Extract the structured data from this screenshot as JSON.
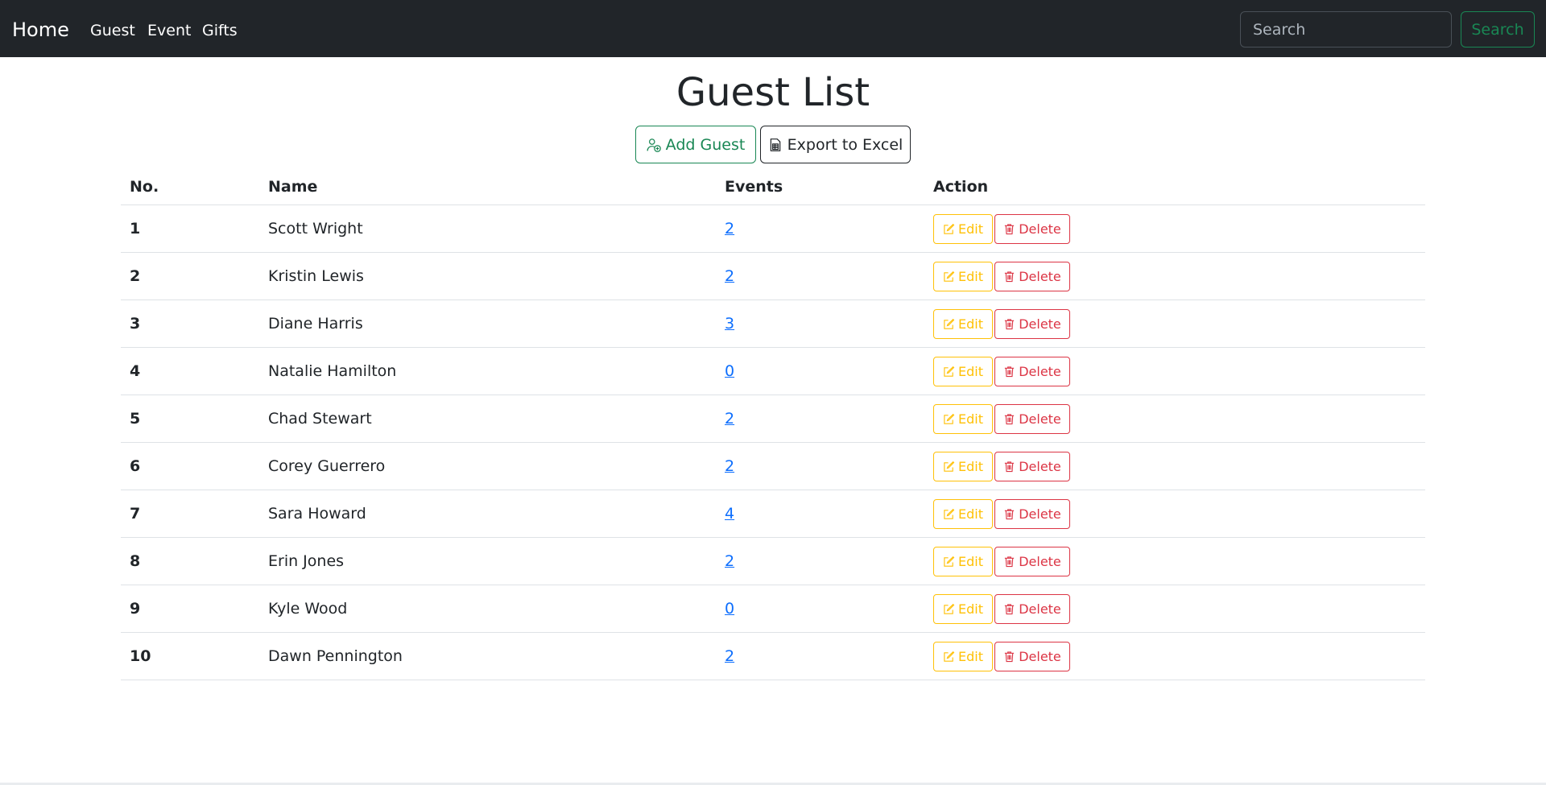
{
  "navbar": {
    "brand": "Home",
    "links": [
      "Guest",
      "Event",
      "Gifts"
    ],
    "search": {
      "placeholder": "Search",
      "button_label": "Search"
    }
  },
  "page": {
    "title": "Guest List",
    "add_button": "Add Guest",
    "export_button": "Export to Excel"
  },
  "table": {
    "headers": {
      "no": "No.",
      "name": "Name",
      "events": "Events",
      "action": "Action"
    },
    "rows": [
      {
        "no": "1",
        "name": "Scott Wright",
        "events": "2"
      },
      {
        "no": "2",
        "name": "Kristin Lewis",
        "events": "2"
      },
      {
        "no": "3",
        "name": "Diane Harris",
        "events": "3"
      },
      {
        "no": "4",
        "name": "Natalie Hamilton",
        "events": "0"
      },
      {
        "no": "5",
        "name": "Chad Stewart",
        "events": "2"
      },
      {
        "no": "6",
        "name": "Corey Guerrero",
        "events": "2"
      },
      {
        "no": "7",
        "name": "Sara Howard",
        "events": "4"
      },
      {
        "no": "8",
        "name": "Erin Jones",
        "events": "2"
      },
      {
        "no": "9",
        "name": "Kyle Wood",
        "events": "0"
      },
      {
        "no": "10",
        "name": "Dawn Pennington",
        "events": "2"
      }
    ],
    "edit_label": "Edit",
    "delete_label": "Delete"
  },
  "icons": {
    "add": "person-add-icon",
    "export": "spreadsheet-file-icon",
    "edit": "pencil-square-icon",
    "delete": "trash-icon"
  },
  "colors": {
    "navbar_bg": "#212529",
    "success": "#198754",
    "warning": "#ffc107",
    "danger": "#dc3545",
    "link": "#0d6efd"
  }
}
